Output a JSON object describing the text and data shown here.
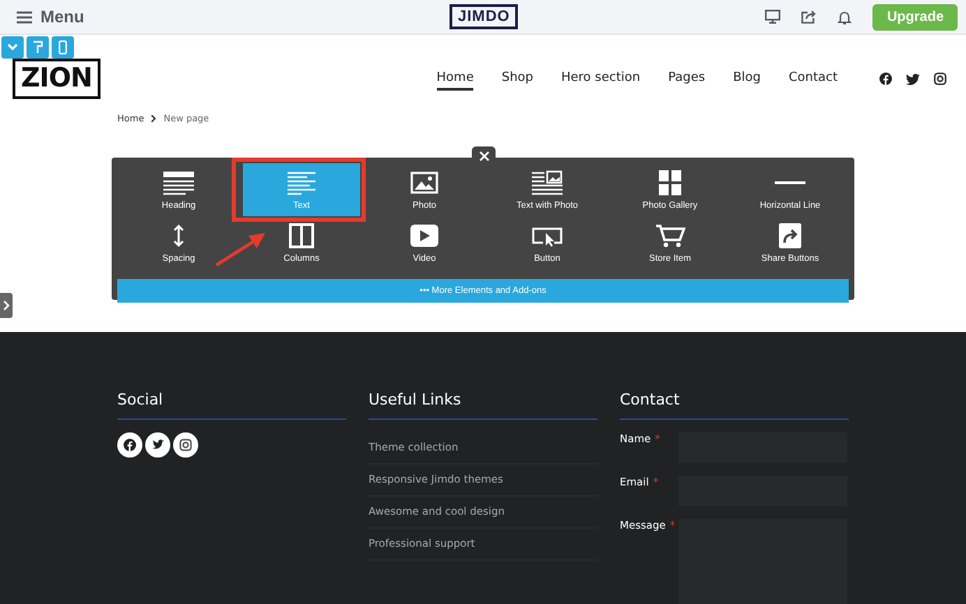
{
  "top_bar": {
    "menu_label": "Menu",
    "logo": "JIMDO",
    "upgrade_button": "Upgrade"
  },
  "site_header": {
    "logo": "ZION",
    "nav": [
      {
        "label": "Home",
        "selected": true
      },
      {
        "label": "Shop",
        "selected": false
      },
      {
        "label": "Hero section",
        "selected": false
      },
      {
        "label": "Pages",
        "selected": false
      },
      {
        "label": "Blog",
        "selected": false
      },
      {
        "label": "Contact",
        "selected": false
      }
    ]
  },
  "breadcrumb": [
    "Home",
    "New page"
  ],
  "element_panel": {
    "elements": [
      {
        "kind": "heading",
        "label": "Heading",
        "selected": false
      },
      {
        "kind": "text",
        "label": "Text",
        "selected": true
      },
      {
        "kind": "photo",
        "label": "Photo",
        "selected": false
      },
      {
        "kind": "text-photo",
        "label": "Text with Photo",
        "selected": false
      },
      {
        "kind": "gallery",
        "label": "Photo Gallery",
        "selected": false
      },
      {
        "kind": "line",
        "label": "Horizontal Line",
        "selected": false
      },
      {
        "kind": "spacing",
        "label": "Spacing",
        "selected": false
      },
      {
        "kind": "columns",
        "label": "Columns",
        "selected": false
      },
      {
        "kind": "video",
        "label": "Video",
        "selected": false
      },
      {
        "kind": "button",
        "label": "Button",
        "selected": false
      },
      {
        "kind": "store",
        "label": "Store Item",
        "selected": false
      },
      {
        "kind": "share",
        "label": "Share Buttons",
        "selected": false
      }
    ],
    "more_button": "••• More Elements and Add-ons"
  },
  "footer": {
    "social": {
      "title": "Social"
    },
    "links": {
      "title": "Useful Links",
      "items": [
        "Theme collection",
        "Responsive Jimdo themes",
        "Awesome and cool design",
        "Professional support"
      ]
    },
    "contact": {
      "title": "Contact",
      "fields": [
        {
          "label": "Name",
          "required_mark": "*",
          "kind": "input"
        },
        {
          "label": "Email",
          "required_mark": "*",
          "kind": "input"
        },
        {
          "label": "Message",
          "required_mark": "*",
          "kind": "textarea"
        }
      ]
    }
  }
}
